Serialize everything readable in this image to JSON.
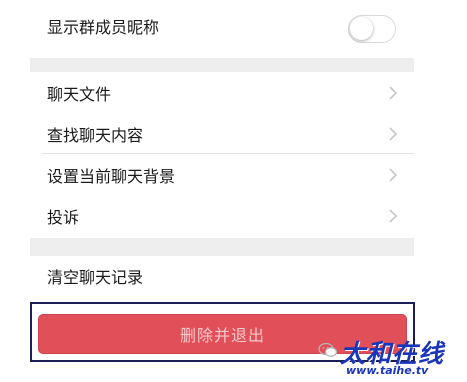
{
  "settings": {
    "show_member_nickname": {
      "label": "显示群成员昵称",
      "enabled": false
    },
    "file_group": [
      {
        "label": "聊天文件"
      },
      {
        "label": "查找聊天内容"
      }
    ],
    "background_group": [
      {
        "label": "设置当前聊天背景"
      },
      {
        "label": "投诉"
      }
    ],
    "clear_history": {
      "label": "清空聊天记录"
    }
  },
  "actions": {
    "delete_and_exit_label": "删除并退出"
  },
  "watermark": {
    "title": "太和在线",
    "url": "www.taihe.tv"
  },
  "colors": {
    "danger_button": "#e14f58",
    "danger_text": "#f6c9cd",
    "section_gap": "#eeeeee",
    "highlight_frame": "#1b1f56",
    "watermark": "#1a35b8"
  },
  "icons": {
    "row_chevron": "chevron-right-icon",
    "toggle": "toggle-switch-icon",
    "watermark_logo": "wechat-logo-icon"
  }
}
